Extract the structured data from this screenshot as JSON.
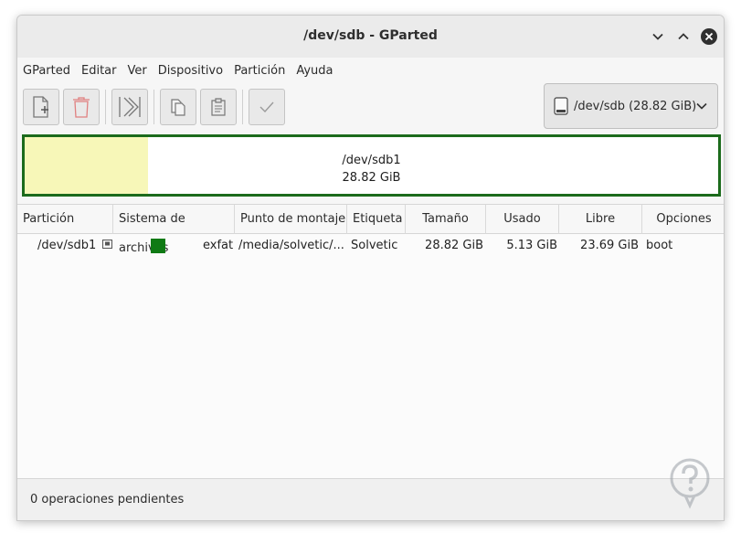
{
  "window": {
    "title": "/dev/sdb - GParted"
  },
  "menu": [
    "GParted",
    "Editar",
    "Ver",
    "Dispositivo",
    "Partición",
    "Ayuda"
  ],
  "toolbar": {
    "buttons": [
      "new-icon",
      "delete-icon",
      "resize-move-icon",
      "copy-icon",
      "paste-icon",
      "apply-icon"
    ]
  },
  "device_selector": {
    "label": "/dev/sdb (28.82 GiB)",
    "icon": "drive-icon"
  },
  "disk_map": {
    "partition": "/dev/sdb1",
    "size": "28.82 GiB",
    "used_fraction": 0.178,
    "used_color": "#f7f7b8",
    "border_color": "#1c6b1c"
  },
  "table": {
    "headers": [
      "Partición",
      "Sistema de archivos",
      "Punto de montaje",
      "Etiqueta",
      "Tamaño",
      "Usado",
      "Libre",
      "Opciones"
    ],
    "rows": [
      {
        "partition": "/dev/sdb1",
        "fs_color": "#0f7a14",
        "filesystem": "exfat",
        "mountpoint": "/media/solvetic/...",
        "label": "Solvetic",
        "size": "28.82 GiB",
        "used": "5.13 GiB",
        "free": "23.69 GiB",
        "flags": "boot"
      }
    ]
  },
  "status": "0 operaciones pendientes"
}
